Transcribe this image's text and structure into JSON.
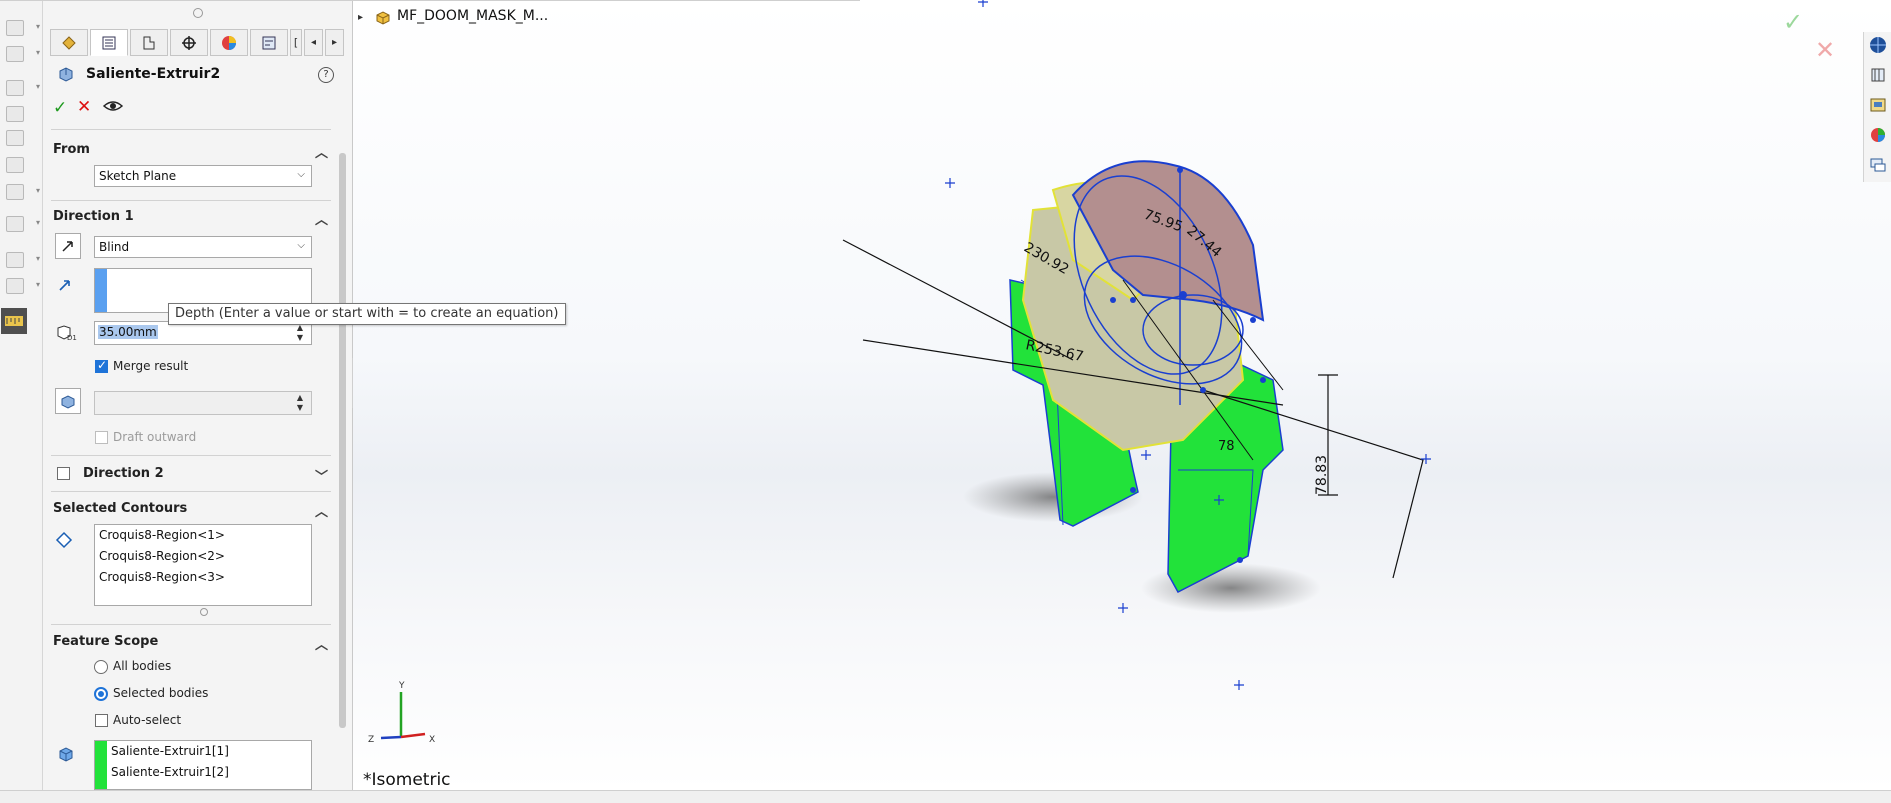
{
  "property_manager": {
    "feature_title": "Saliente-Extruir2",
    "from": {
      "header": "From",
      "selected": "Sketch Plane"
    },
    "direction1": {
      "header": "Direction 1",
      "end_condition": "Blind",
      "depth_value": "35.00mm",
      "merge_result_label": "Merge result",
      "draft_outward_label": "Draft outward"
    },
    "direction2": {
      "header": "Direction 2"
    },
    "selected_contours": {
      "header": "Selected Contours",
      "items": [
        "Croquis8-Region<1>",
        "Croquis8-Region<2>",
        "Croquis8-Region<3>"
      ]
    },
    "feature_scope": {
      "header": "Feature Scope",
      "all_bodies_label": "All bodies",
      "selected_bodies_label": "Selected bodies",
      "auto_select_label": "Auto-select",
      "bodies": [
        "Saliente-Extruir1[1]",
        "Saliente-Extruir1[2]"
      ]
    }
  },
  "tooltip": {
    "text": "Depth (Enter a value or start with = to create an equation)"
  },
  "viewport": {
    "tree_title": "MF_DOOM_MASK_M...",
    "view_label": "*Isometric",
    "dimensions": [
      "75.95",
      "27.44",
      "230.92",
      "R253.67",
      "78.83",
      "78"
    ]
  },
  "colors": {
    "accent": "#1e73d8",
    "body_green": "#22e23a",
    "sketch_blue": "#1a3fd0"
  }
}
